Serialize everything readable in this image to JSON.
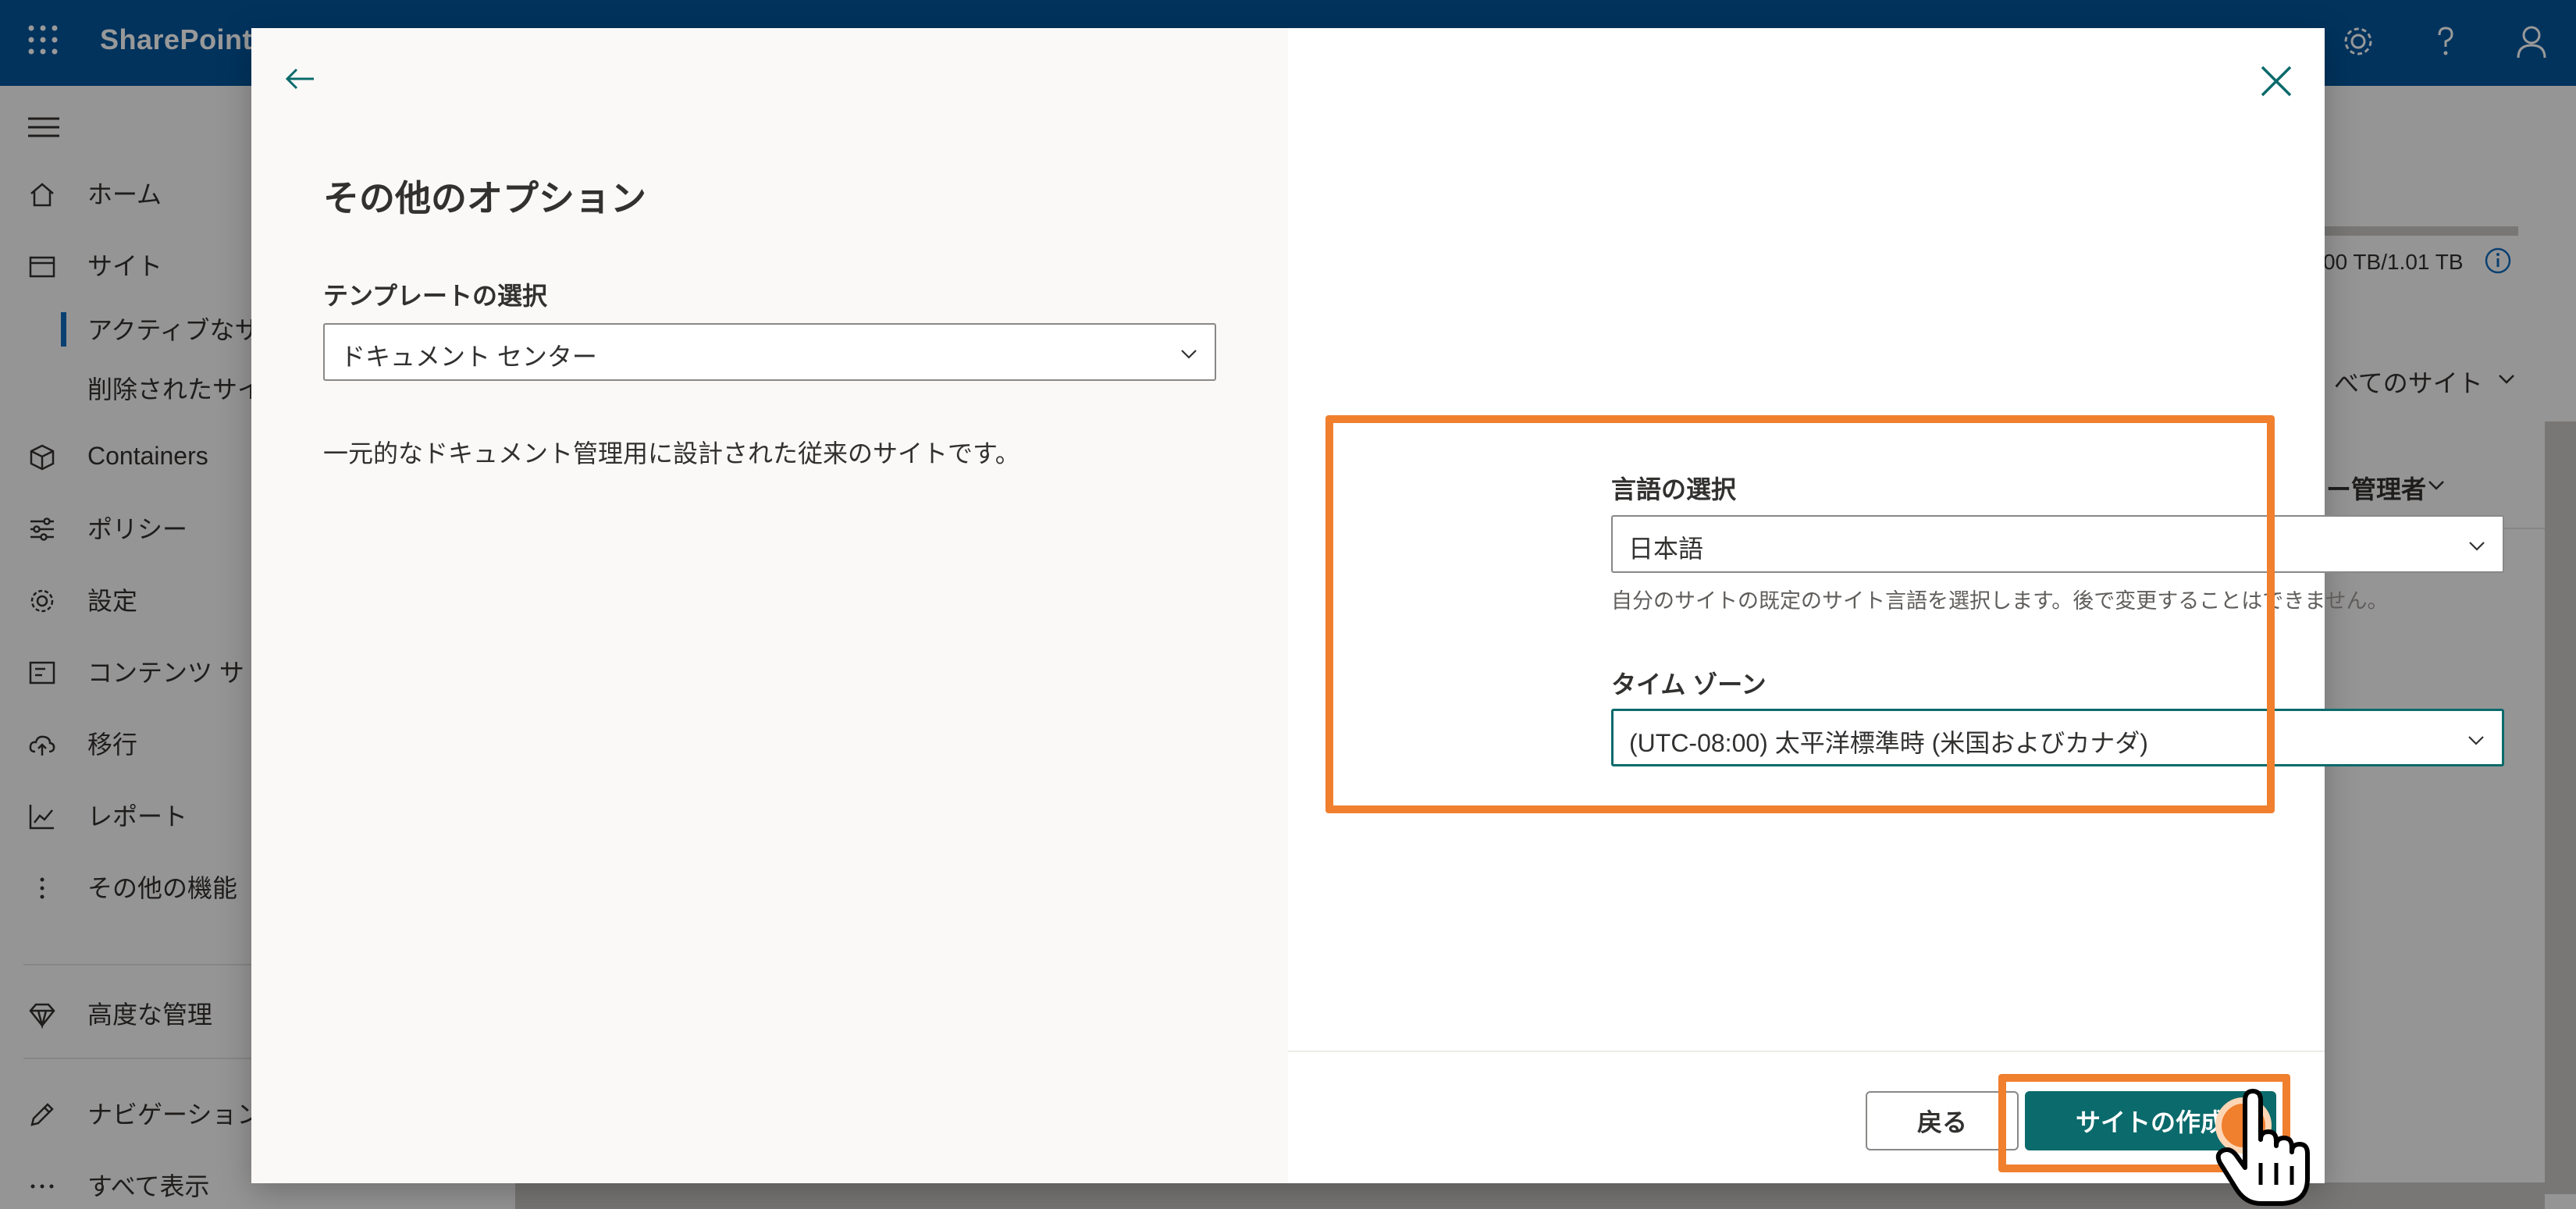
{
  "app": {
    "brand": "SharePoint"
  },
  "icons": {
    "waffle": "waffle-icon",
    "settings": "gear-icon",
    "help": "help-icon",
    "account": "person-icon",
    "back": "arrow-left-icon",
    "close": "close-icon",
    "chevron": "chevron-down-icon"
  },
  "colors": {
    "brand": "#03569b",
    "accent": "#0b6a6b",
    "highlight": "#f07f2e"
  },
  "sidenav": {
    "items": [
      {
        "label": "ホーム",
        "icon": "home-icon"
      },
      {
        "label": "サイト",
        "icon": "site-icon"
      },
      {
        "label": "アクティブなサ",
        "icon": ""
      },
      {
        "label": "削除されたサイ",
        "icon": ""
      },
      {
        "label": "Containers",
        "icon": "container-icon"
      },
      {
        "label": "ポリシー",
        "icon": "policy-icon"
      },
      {
        "label": "設定",
        "icon": "gear-icon"
      },
      {
        "label": "コンテンツ サ",
        "icon": "content-icon"
      },
      {
        "label": "移行",
        "icon": "cloud-upload-icon"
      },
      {
        "label": "レポート",
        "icon": "chart-icon"
      },
      {
        "label": "その他の機能",
        "icon": "more-vertical-icon"
      },
      {
        "label": "高度な管理",
        "icon": "diamond-icon"
      },
      {
        "label": "ナビゲーション",
        "icon": "pencil-icon"
      },
      {
        "label": "すべて表示",
        "icon": "more-icon"
      }
    ]
  },
  "right_bg": {
    "storage": "00 TB/1.01 TB",
    "view": "べてのサイト",
    "column": "ー管理者"
  },
  "dialog": {
    "title": "その他のオプション",
    "template": {
      "label": "テンプレートの選択",
      "value": "ドキュメント センター",
      "description": "一元的なドキュメント管理用に設計された従来のサイトです。"
    },
    "language": {
      "label": "言語の選択",
      "value": "日本語",
      "help": "自分のサイトの既定のサイト言語を選択します。後で変更することはできません。"
    },
    "timezone": {
      "label": "タイム ゾーン",
      "value": "(UTC-08:00) 太平洋標準時 (米国およびカナダ)"
    },
    "buttons": {
      "back": "戻る",
      "create": "サイトの作成"
    }
  }
}
